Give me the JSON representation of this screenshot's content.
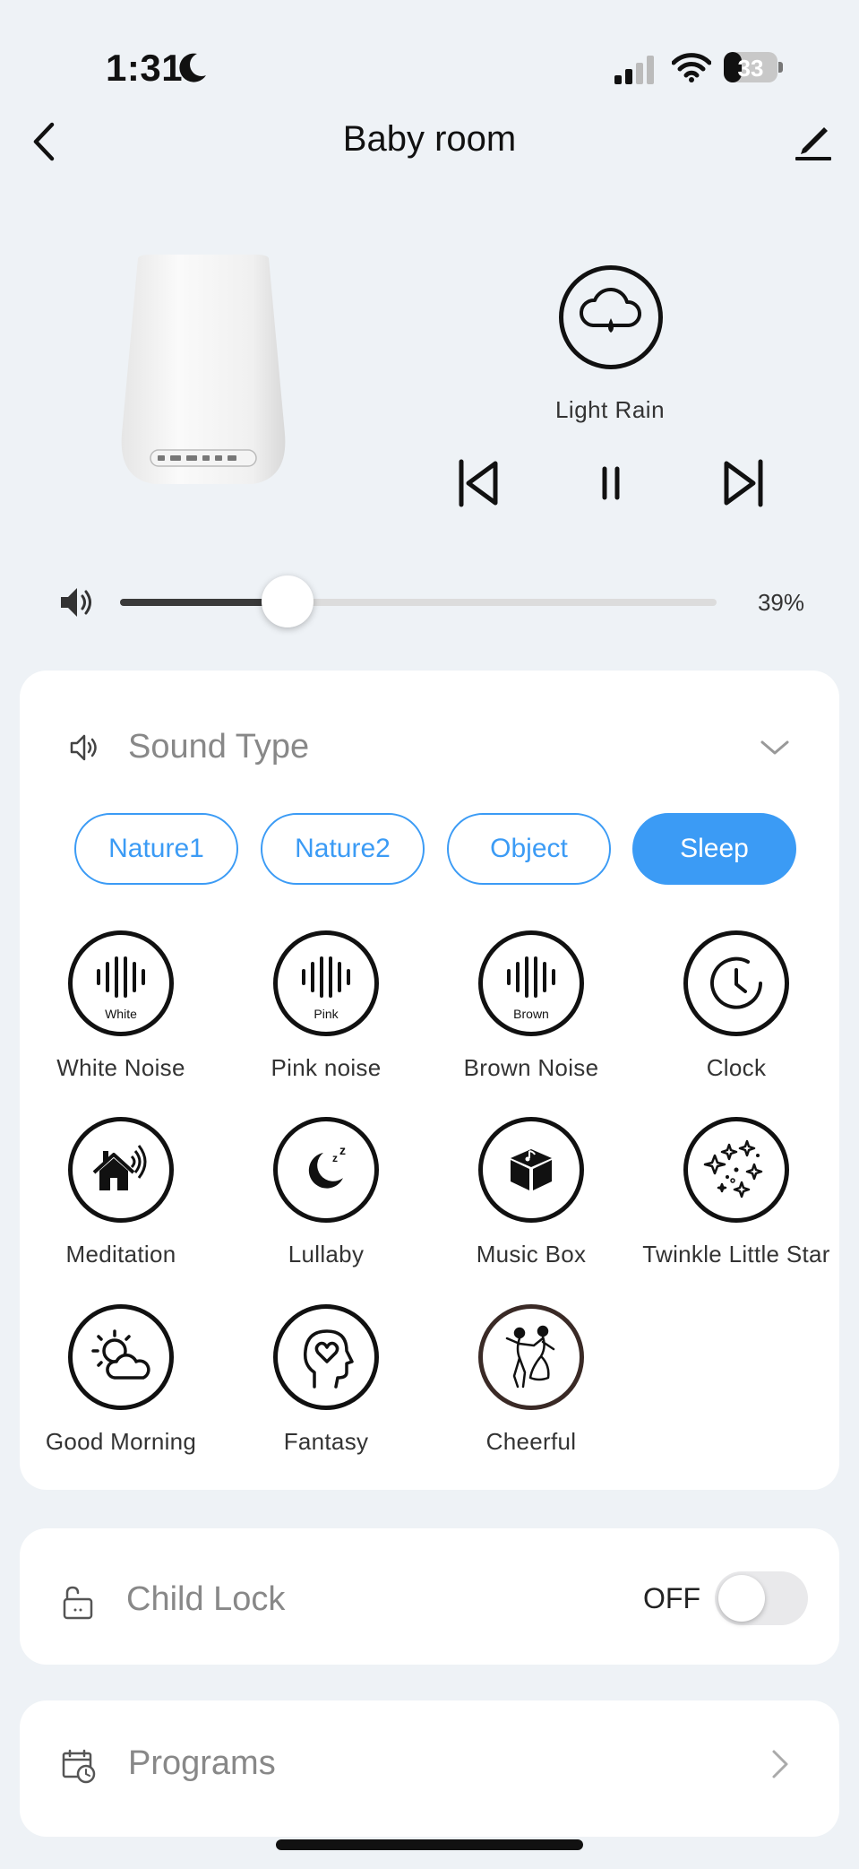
{
  "status_bar": {
    "time": "1:31",
    "battery": "33"
  },
  "header": {
    "title": "Baby room"
  },
  "now_playing": {
    "name": "Light Rain"
  },
  "volume": {
    "level": 0.39,
    "label": "39%"
  },
  "sound_type": {
    "label": "Sound Type",
    "categories": [
      {
        "label": "Nature1",
        "active": false
      },
      {
        "label": "Nature2",
        "active": false
      },
      {
        "label": "Object",
        "active": false
      },
      {
        "label": "Sleep",
        "active": true
      }
    ],
    "sounds": [
      {
        "label": "White Noise",
        "icon": "white-noise-icon",
        "tag": "White"
      },
      {
        "label": "Pink noise",
        "icon": "pink-noise-icon",
        "tag": "Pink"
      },
      {
        "label": "Brown Noise",
        "icon": "brown-noise-icon",
        "tag": "Brown"
      },
      {
        "label": "Clock",
        "icon": "clock-icon"
      },
      {
        "label": "Meditation",
        "icon": "meditation-icon"
      },
      {
        "label": "Lullaby",
        "icon": "lullaby-icon"
      },
      {
        "label": "Music Box",
        "icon": "music-box-icon"
      },
      {
        "label": "Twinkle Little Star",
        "icon": "twinkle-star-icon"
      },
      {
        "label": "Good Morning",
        "icon": "good-morning-icon"
      },
      {
        "label": "Fantasy",
        "icon": "fantasy-icon"
      },
      {
        "label": "Cheerful",
        "icon": "cheerful-icon"
      }
    ]
  },
  "child_lock": {
    "label": "Child Lock",
    "state": "OFF"
  },
  "programs": {
    "label": "Programs"
  },
  "colors": {
    "accent": "#3b9bf5",
    "background": "#eef2f6"
  }
}
